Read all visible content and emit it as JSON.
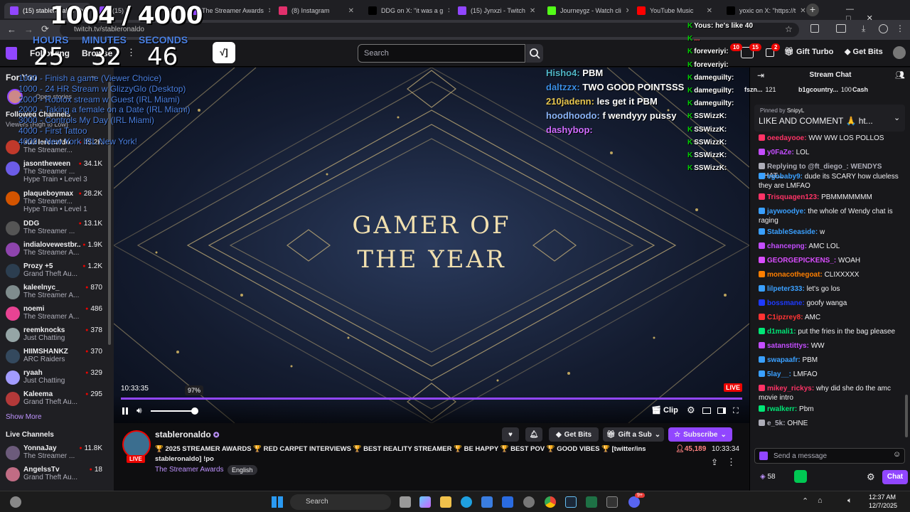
{
  "browser": {
    "tabs": [
      {
        "label": "(15) stableronaldo",
        "color": "#9146ff"
      },
      {
        "label": "(15) D",
        "color": "#9146ff"
      },
      {
        "label": "The Streamer Awards",
        "color": "#9146ff"
      },
      {
        "label": "(8) Instagram",
        "color": "#e1306c"
      },
      {
        "label": "DDG on X: \"it was a g",
        "color": "#000000"
      },
      {
        "label": "(15) Jynxzi - Twitch",
        "color": "#9146ff"
      },
      {
        "label": "Journeygz - Watch cli",
        "color": "#53fc18"
      },
      {
        "label": "YouTube Music",
        "color": "#ff0000"
      },
      {
        "label": "yoxic on X: \"https://t",
        "color": "#000000"
      }
    ],
    "url": "twitch.tv/stableronaldo"
  },
  "timer": {
    "count": "1004 / 4000",
    "hours_label": "HOURS",
    "minutes_label": "MINUTES",
    "seconds_label": "SECONDS",
    "hours": "25",
    "minutes": "32",
    "seconds": "46",
    "goals": [
      "1000 - Finish a game (Viewer Choice)",
      "1000 - 24 HR Stream w GlizzyGlo (Desktop)",
      "2000 - Roblox stream w Guest (IRL Miami)",
      "2000 - Taking a female on a Date (IRL Miami)",
      "3000 - Controls My Day (IRL Miami)",
      "4000 - First Tattoo",
      "4000 - New York IRL New York!"
    ]
  },
  "topnav": {
    "following": "Following",
    "browse": "Browse",
    "search_placeholder": "Search",
    "gift_turbo": "Gift Turbo",
    "get_bits": "Get Bits",
    "notif_badge": "10",
    "whisper_badge": "15",
    "inbox_badge": "2"
  },
  "sidebar": {
    "for_you": "For You",
    "open_stories": "Open stories",
    "followed_channels": "Followed Channels",
    "sort": "Viewers (High to Low)",
    "channels": [
      {
        "name": "stableronaldo",
        "game": "The Streamer...",
        "viewers": "45.2K",
        "hype": "",
        "color": "#c0392b"
      },
      {
        "name": "jasontheween",
        "game": "The Streamer ...",
        "viewers": "34.1K",
        "hype": "Hype Train • Level 3",
        "color": "#6c5ce7"
      },
      {
        "name": "plaqueboymax",
        "game": "The Streamer...",
        "viewers": "28.2K",
        "hype": "Hype Train • Level 1",
        "color": "#d35400"
      },
      {
        "name": "DDG",
        "game": "The Streamer ...",
        "viewers": "13.1K",
        "hype": "",
        "color": "#555555"
      },
      {
        "name": "indialovewestbr...",
        "game": "The Streamer A...",
        "viewers": "1.9K",
        "hype": "",
        "color": "#8e44ad"
      },
      {
        "name": "Prozy +5",
        "game": "Grand Theft Au...",
        "viewers": "1.2K",
        "hype": "",
        "color": "#2c3e50"
      },
      {
        "name": "kaleelnyc_",
        "game": "The Streamer A...",
        "viewers": "870",
        "hype": "",
        "color": "#7f8c8d"
      },
      {
        "name": "noemi",
        "game": "The Streamer A...",
        "viewers": "486",
        "hype": "",
        "color": "#e84393"
      },
      {
        "name": "reemknocks",
        "game": "Just Chatting",
        "viewers": "378",
        "hype": "",
        "color": "#95a5a6"
      },
      {
        "name": "HIIMSHANKZ",
        "game": "ARC Raiders",
        "viewers": "370",
        "hype": "",
        "color": "#34495e"
      },
      {
        "name": "ryaah",
        "game": "Just Chatting",
        "viewers": "329",
        "hype": "",
        "color": "#a29bfe"
      },
      {
        "name": "Kaleema",
        "game": "Grand Theft Au...",
        "viewers": "295",
        "hype": "",
        "color": "#b33939"
      }
    ],
    "show_more": "Show More",
    "live_channels": "Live Channels",
    "live": [
      {
        "name": "YonnaJay",
        "game": "The Streamer ...",
        "viewers": "11.8K",
        "color": "#6c5b7b"
      },
      {
        "name": "AngelssTv",
        "game": "Grand Theft Au...",
        "viewers": "18",
        "color": "#c06c84"
      }
    ]
  },
  "player": {
    "headline_1": "GAMER OF",
    "headline_2": "THE YEAR",
    "elapsed": "10:33:35",
    "volume_tooltip": "97%",
    "volume": 0.97,
    "live_badge": "LIVE",
    "clip": "Clip",
    "overlay_chat": [
      {
        "user": "Hisho4:",
        "msg": "PBM",
        "color": "#4fb5c7"
      },
      {
        "user": "daltzzx:",
        "msg": "TWO GOOD POINTSSS",
        "color": "#3a8ee6"
      },
      {
        "user": "210jadenn:",
        "msg": "les get it PBM",
        "color": "#e6c54f"
      },
      {
        "user": "hoodhoodo:",
        "msg": "f wendyyy pussy",
        "color": "#8ab4f8"
      },
      {
        "user": "dashybop:",
        "msg": "",
        "color": "#d06cff"
      }
    ]
  },
  "stream": {
    "channel": "stableronaldo",
    "title_line1": "🏆 2025 STREAMER AWARDS 🏆 RED CARPET INTERVIEWS 🏆 BEST REALITY STREAMER 🏆 BE HAPPY 🏆 BEST POV 🏆 GOOD VIBES 🏆 [twitter/insta",
    "title_line2": "stableronaldo] !po",
    "category": "The Streamer Awards",
    "tag": "English",
    "viewers": "45,189",
    "uptime": "10:33:34",
    "get_bits": "Get Bits",
    "gift_sub": "Gift a Sub",
    "subscribe": "Subscribe",
    "live": "LIVE"
  },
  "overlay_log": [
    {
      "user": "Yous:",
      "msg": "he's like 40",
      "color": "#ffffff"
    },
    {
      "user": "...",
      "msg": "",
      "color": "#ff4d4d"
    },
    {
      "user": "foreveriyi:",
      "msg": "",
      "color": "#ffffff"
    },
    {
      "user": "foreveriyi:",
      "msg": "",
      "color": "#ffffff"
    },
    {
      "user": "dameguilty:",
      "msg": "",
      "color": "#ffffff"
    },
    {
      "user": "dameguilty:",
      "msg": "",
      "color": "#ffffff"
    },
    {
      "user": "dameguilty:",
      "msg": "",
      "color": "#ffffff"
    },
    {
      "user": "SSWizzK:",
      "msg": "",
      "color": "#ffffff"
    },
    {
      "user": "SSWizzK:",
      "msg": "",
      "color": "#ffffff"
    },
    {
      "user": "SSWizzK:",
      "msg": "",
      "color": "#ffffff"
    },
    {
      "user": "SSWizzK:",
      "msg": "",
      "color": "#ffffff"
    },
    {
      "user": "SSWizzK:",
      "msg": "",
      "color": "#ffffff"
    }
  ],
  "chat": {
    "title": "Stream Chat",
    "leaders": [
      {
        "name": "fszn...",
        "amount": "121"
      },
      {
        "name": "b1gcountry...",
        "amount": "100"
      },
      {
        "name": "Cash",
        "amount": ""
      }
    ],
    "pinned_by": "Pinned by",
    "pinned_user": "SnipyL",
    "pinned_msg": "LIKE AND COMMENT 🙏 ht...",
    "messages": [
      {
        "user": "oeedayooe:",
        "msg": "WW WW LOS POLLOS",
        "color": "#ff3366"
      },
      {
        "user": "y0FaZe:",
        "msg": "LOL",
        "color": "#c44dff"
      },
      {
        "user": "Replying to @ft_diego_: WENDYS CHAT...",
        "msg": "",
        "color": "#adadb8"
      },
      {
        "user": "egobaby9:",
        "msg": "dude its SCARY how clueless they are LMFAO",
        "color": "#3aa0ff"
      },
      {
        "user": "Trisquagen123:",
        "msg": "PBMMMMMMM",
        "color": "#ff3366"
      },
      {
        "user": "jaywoodye:",
        "msg": "the whole of Wendy chat is raging",
        "color": "#3aa0ff"
      },
      {
        "user": "StableSeaside:",
        "msg": "w",
        "color": "#3aa0ff"
      },
      {
        "user": "chancepng:",
        "msg": "AMC LOL",
        "color": "#c44dff"
      },
      {
        "user": "GEORGEPICKENS_:",
        "msg": "WOAH",
        "color": "#d94dff"
      },
      {
        "user": "monacothegoat:",
        "msg": "CLIXXXXX",
        "color": "#ff7f00"
      },
      {
        "user": "lilpeter333:",
        "msg": "let's go los",
        "color": "#3aa0ff"
      },
      {
        "user": "bossmane:",
        "msg": "goofy wanga",
        "color": "#1e3aff"
      },
      {
        "user": "C1ipzrey8:",
        "msg": "AMC",
        "color": "#ff3333"
      },
      {
        "user": "d1mali1:",
        "msg": "put the fries in the bag pleasee",
        "color": "#00e676"
      },
      {
        "user": "satanstittys:",
        "msg": "WW",
        "color": "#c44dff"
      },
      {
        "user": "swapaafr:",
        "msg": "PBM",
        "color": "#3aa0ff"
      },
      {
        "user": "5lay__:",
        "msg": "LMFAO",
        "color": "#3aa0ff"
      },
      {
        "user": "mikey_rickys:",
        "msg": "why did she do the amc movie intro",
        "color": "#ff3366"
      },
      {
        "user": "rwalkerr:",
        "msg": "Pbm",
        "color": "#00e676"
      },
      {
        "user": "e_5k:",
        "msg": "OHNE",
        "color": "#adadb8"
      }
    ],
    "input_placeholder": "Send a message",
    "points": "58",
    "chat_button": "Chat"
  },
  "taskbar": {
    "search": "Search",
    "time": "12:37 AM",
    "date": "12/7/2025",
    "badge": "9+"
  }
}
